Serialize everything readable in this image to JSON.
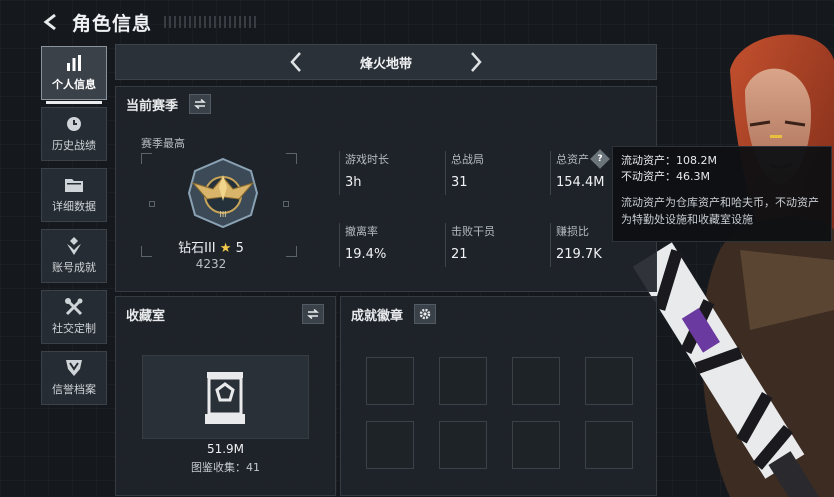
{
  "header": {
    "title": "角色信息"
  },
  "nav": [
    {
      "label": "个人信息",
      "icon": "bar-chart-icon",
      "active": true
    },
    {
      "label": "历史战绩",
      "icon": "clock-icon",
      "active": false
    },
    {
      "label": "详细数据",
      "icon": "folder-icon",
      "active": false
    },
    {
      "label": "账号成就",
      "icon": "achievement-icon",
      "active": false
    },
    {
      "label": "社交定制",
      "icon": "tools-icon",
      "active": false
    },
    {
      "label": "信誉档案",
      "icon": "shield-icon",
      "active": false
    }
  ],
  "map_selector": {
    "name": "烽火地带"
  },
  "season": {
    "title": "当前赛季",
    "subtitle": "赛季最高",
    "rank_name": "钻石III",
    "rank_stars": "5",
    "rank_score": "4232",
    "stats": [
      {
        "label": "游戏时长",
        "value": "3h"
      },
      {
        "label": "总战局",
        "value": "31"
      },
      {
        "label": "总资产",
        "value": "154.4M"
      },
      {
        "label": "撤离率",
        "value": "19.4%"
      },
      {
        "label": "击败干员",
        "value": "21"
      },
      {
        "label": "赚损比",
        "value": "219.7K"
      }
    ]
  },
  "tooltip": {
    "liquid": "流动资产：108.2M",
    "fixed": "不动资产：46.3M",
    "note_line1": "流动资产为仓库资产和哈夫币，不动资产",
    "note_line2": "为特勤处设施和收藏室设施"
  },
  "collection": {
    "title": "收藏室",
    "value": "51.9M",
    "count": "图鉴收集：41"
  },
  "achievements": {
    "title": "成就徽章"
  },
  "colors": {
    "accent_gold": "#f2c94c",
    "panel_bg": "#1f242a",
    "page_bg": "#15191e"
  }
}
